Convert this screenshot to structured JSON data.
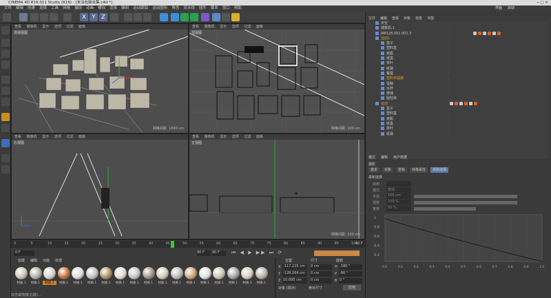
{
  "window": {
    "title": "CINEMA 4D R16.011 Studio (R16) - [米淡包装合集.c4d *]"
  },
  "menubar": {
    "items": [
      "文件",
      "编辑",
      "创建",
      "选择",
      "工具",
      "网格",
      "捕捉",
      "动画",
      "模拟",
      "渲染",
      "雕刻",
      "运动跟踪",
      "运动图形",
      "角色",
      "流水线",
      "插件",
      "脚本",
      "窗口",
      "帮助"
    ]
  },
  "right_menubar": {
    "items": [
      "界面",
      "启动"
    ]
  },
  "viewports": {
    "perspective": {
      "label": "透视视图",
      "menu": [
        "查看",
        "摄像机",
        "显示",
        "选项",
        "过滤",
        "面板"
      ],
      "grid": "网格间距: 1000 cm"
    },
    "top": {
      "label": "顶视图",
      "menu": [
        "查看",
        "摄像机",
        "显示",
        "选项",
        "过滤",
        "面板"
      ],
      "grid": "网格间距: 100 cm"
    },
    "right": {
      "label": "右视图",
      "menu": [
        "查看",
        "摄像机",
        "显示",
        "选项",
        "过滤",
        "面板"
      ],
      "grid": ""
    },
    "front": {
      "label": "正视图",
      "menu": [
        "查看",
        "摄像机",
        "显示",
        "选项",
        "过滤",
        "面板"
      ],
      "grid": "网格间距: 100 cm"
    }
  },
  "timeline": {
    "ticks": [
      "0",
      "5",
      "10",
      "15",
      "20",
      "25",
      "30",
      "35",
      "40",
      "45",
      "50",
      "55",
      "60",
      "65",
      "70",
      "75",
      "80",
      "85",
      "90",
      "95",
      "100"
    ],
    "current_frame": "0 F",
    "start": "0 F",
    "end": "90 F",
    "end2": "90 F",
    "frame_readout": "42 F"
  },
  "materials": {
    "menu": [
      "创建",
      "编辑",
      "功能",
      "纹理"
    ],
    "row1": [
      "材质.1",
      "材质.1",
      "材质.2",
      "材质.1",
      "材质.1",
      "材质.1",
      "材质.1",
      "材质.1",
      "材质.1",
      "材质.1",
      "材质.1",
      "材质.1",
      "材质.1",
      "材质.1",
      "材质.1",
      "材质.1",
      "材质.1",
      "材质.1"
    ],
    "highlight_index": 2
  },
  "coords": {
    "headers": [
      "位置",
      "尺寸",
      "旋转"
    ],
    "rows": [
      {
        "axis": "X",
        "pos": "-117.225 cm",
        "size": "0 cm",
        "rot_label": "H",
        "rot": "-180 °"
      },
      {
        "axis": "Y",
        "pos": "-128.164 cm",
        "size": "0 cm",
        "rot_label": "P",
        "rot": "-90 °"
      },
      {
        "axis": "Z",
        "pos": "10.095 cm",
        "size": "0 cm",
        "rot_label": "B",
        "rot": "0 °"
      }
    ],
    "mode": "对象 (相对)",
    "size_mode": "绝对尺寸",
    "apply": "应用"
  },
  "status": "双击或拖拽(右键)...",
  "objects": {
    "menu": [
      "文件",
      "编辑",
      "查看",
      "对象",
      "标签",
      "书签"
    ],
    "rows": [
      {
        "name": "天空",
        "indent": 0,
        "highlight": false
      },
      {
        "name": "摄像机.1",
        "indent": 0,
        "highlight": false
      },
      {
        "name": "AM128.001.001.3",
        "indent": 0,
        "highlight": false
      },
      {
        "name": "运动1",
        "indent": 0,
        "highlight": true
      },
      {
        "name": "盒子",
        "indent": 1,
        "highlight": false
      },
      {
        "name": "塑料盒",
        "indent": 1,
        "highlight": false
      },
      {
        "name": "瓷瓶",
        "indent": 1,
        "highlight": false
      },
      {
        "name": "纸盒",
        "indent": 1,
        "highlight": false
      },
      {
        "name": "茶叶",
        "indent": 1,
        "highlight": false
      },
      {
        "name": "纸袋",
        "indent": 1,
        "highlight": false
      },
      {
        "name": "餐盒",
        "indent": 1,
        "highlight": false
      },
      {
        "name": "塑料手提袋",
        "indent": 1,
        "highlight": true
      },
      {
        "name": "蛋糕",
        "indent": 1,
        "highlight": false
      },
      {
        "name": "水杯",
        "indent": 1,
        "highlight": false
      },
      {
        "name": "玻璃",
        "indent": 1,
        "highlight": false
      },
      {
        "name": "圆柱体",
        "indent": 1,
        "highlight": false
      },
      {
        "name": "运动",
        "indent": 0,
        "highlight": true
      },
      {
        "name": "盒子",
        "indent": 1,
        "highlight": false
      },
      {
        "name": "塑料盒",
        "indent": 1,
        "highlight": false
      },
      {
        "name": "瓷瓶",
        "indent": 1,
        "highlight": false
      },
      {
        "name": "纸盒",
        "indent": 1,
        "highlight": false
      },
      {
        "name": "茶叶",
        "indent": 1,
        "highlight": false
      },
      {
        "name": "纸袋",
        "indent": 1,
        "highlight": false
      }
    ]
  },
  "attributes": {
    "menu": [
      "模式",
      "编辑",
      "用户数据"
    ],
    "object_name": "摄影",
    "tabs": [
      "基本",
      "对象",
      "坐标",
      "对象属性",
      "柔和选择"
    ],
    "section": "柔和选择",
    "fields": [
      {
        "label": "启用",
        "value": ""
      },
      {
        "label": "模式",
        "value": "直线"
      },
      {
        "label": "半径",
        "value": "100 cm"
      },
      {
        "label": "强度",
        "value": "100 %"
      },
      {
        "label": "宽度",
        "value": "50 %"
      }
    ],
    "graph_y": [
      "1",
      "0.8",
      "0.6",
      "0.4",
      "0.2"
    ],
    "graph_x": [
      "0.0",
      "0.1",
      "0.2",
      "0.3",
      "0.4",
      "0.5",
      "0.6",
      "0.7",
      "0.8",
      "0.9",
      "1.0"
    ]
  }
}
